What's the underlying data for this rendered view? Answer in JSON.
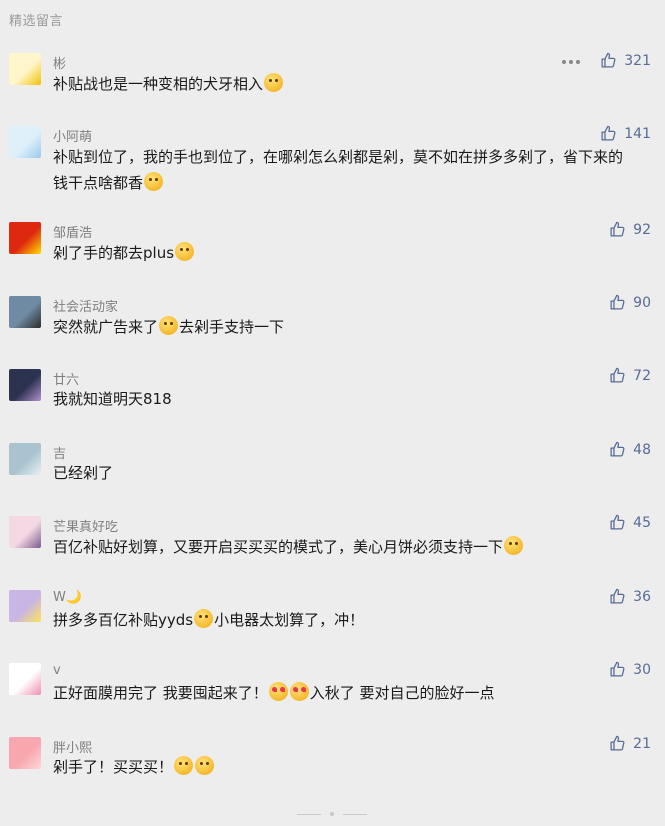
{
  "section_title": "精选留言",
  "comments": [
    {
      "nickname": "彬",
      "content_parts": [
        "补贴战也是一种变相的犬牙相入",
        ""
      ],
      "emoji": [
        "smile-emoji"
      ],
      "likes": "321",
      "avatar_color": "#fff6cc",
      "avatar_accent": "#f2c200"
    },
    {
      "nickname": "小阿萌",
      "content_parts": [
        "补贴到位了，我的手也到位了，在哪剁怎么剁都是剁，莫不如在拼多多剁了，省下来的钱干点啥都香",
        ""
      ],
      "emoji": [
        "grin-emoji"
      ],
      "likes": "141",
      "avatar_color": "#dff0fb",
      "avatar_accent": "#9cc9ea"
    },
    {
      "nickname": "邹盾浩",
      "content_parts": [
        "剁了手的都去plus",
        ""
      ],
      "emoji": [
        "grin-emoji"
      ],
      "likes": "92",
      "avatar_color": "#de2910",
      "avatar_accent": "#ffde00"
    },
    {
      "nickname": "社会活动家",
      "content_parts": [
        "突然就广告来了",
        "去剁手支持一下"
      ],
      "emoji": [
        "thinking-emoji"
      ],
      "likes": "90",
      "avatar_color": "#6f8aa3",
      "avatar_accent": "#2b2b2b"
    },
    {
      "nickname": "廿六",
      "content_parts": [
        "我就知道明天818",
        ""
      ],
      "emoji": [],
      "likes": "72",
      "avatar_color": "#2c3350",
      "avatar_accent": "#b48fd0"
    },
    {
      "nickname": "吉",
      "content_parts": [
        "已经剁了",
        ""
      ],
      "emoji": [],
      "likes": "48",
      "avatar_color": "#a9c4cf",
      "avatar_accent": "#e8f1f5"
    },
    {
      "nickname": "芒果真好吃",
      "content_parts": [
        "百亿补贴好划算，又要开启买买买的模式了，美心月饼必须支持一下",
        ""
      ],
      "emoji": [
        "tongue-emoji"
      ],
      "likes": "45",
      "avatar_color": "#f4d8e3",
      "avatar_accent": "#7d5a8f"
    },
    {
      "nickname": "W🌙",
      "content_parts": [
        "拼多多百亿补贴yyds",
        "小电器太划算了，冲！"
      ],
      "emoji": [
        "grin-emoji"
      ],
      "likes": "36",
      "avatar_color": "#c9b6e4",
      "avatar_accent": "#ffe35a"
    },
    {
      "nickname": "v",
      "content_parts": [
        "正好面膜用完了 我要囤起来了！",
        "入秋了 要对自己的脸好一点"
      ],
      "emoji": [
        "heart-eyes-emoji",
        "heart-eyes-emoji"
      ],
      "likes": "30",
      "avatar_color": "#ffffff",
      "avatar_accent": "#f08db2"
    },
    {
      "nickname": "胖小熙",
      "content_parts": [
        "剁手了！买买买！",
        ""
      ],
      "emoji": [
        "cool-emoji",
        "cool-emoji"
      ],
      "likes": "21",
      "avatar_color": "#f7a7ad",
      "avatar_accent": "#ffd7da"
    }
  ],
  "more_icon": "more-dots-icon",
  "like_icon": "thumbs-up-icon",
  "accent_color": "#576b95"
}
